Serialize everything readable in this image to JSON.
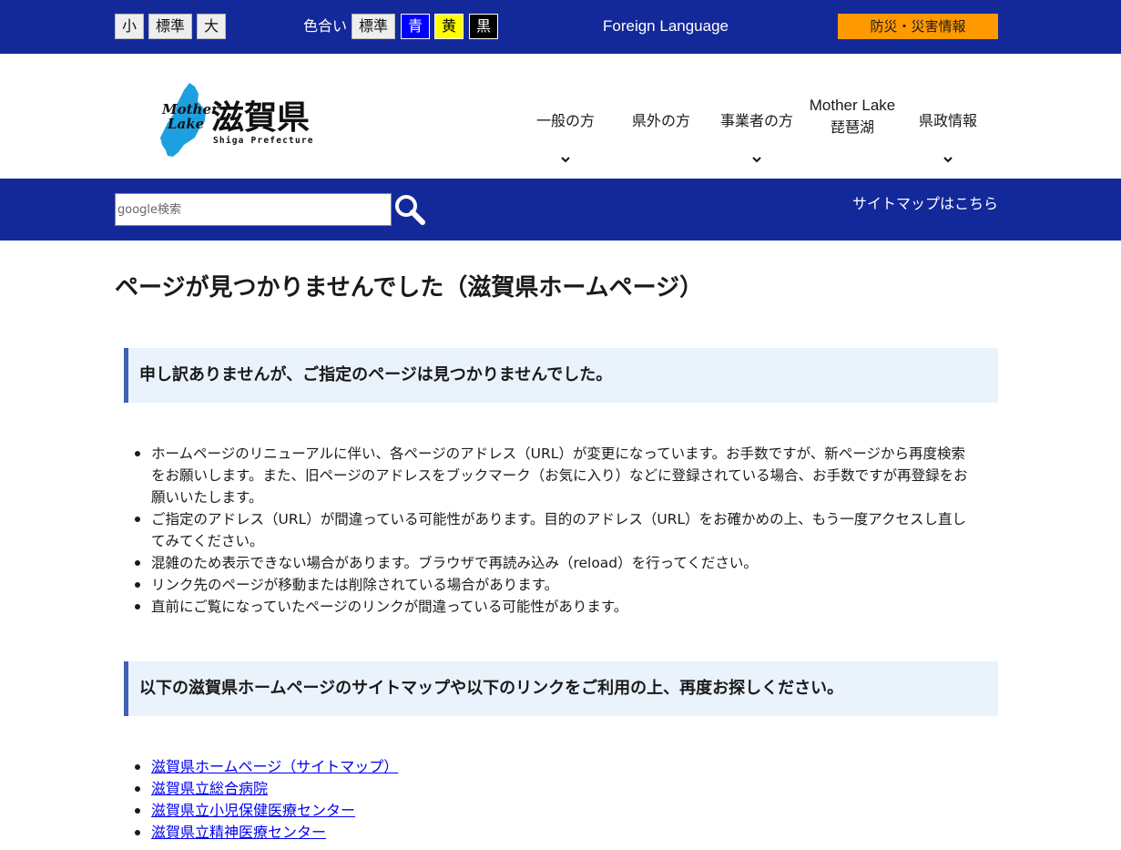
{
  "topbar": {
    "size_buttons": [
      "小",
      "標準",
      "大"
    ],
    "color_label": "色合い",
    "color_buttons": [
      {
        "label": "標準",
        "bg": "#eeeeee",
        "fg": "#111111"
      },
      {
        "label": "青",
        "bg": "#0000ff",
        "fg": "#ffffff"
      },
      {
        "label": "黄",
        "bg": "#ffff00",
        "fg": "#000000"
      },
      {
        "label": "黒",
        "bg": "#000000",
        "fg": "#ffffff"
      }
    ],
    "foreign_language": "Foreign Language",
    "disaster_info": "防災・災害情報"
  },
  "header": {
    "logo": {
      "mark_text": [
        "Mother",
        "Lake"
      ],
      "name": "滋賀県",
      "subtitle": "Shiga Prefecture"
    },
    "nav": [
      {
        "lines": [
          "一般の方"
        ],
        "has_dropdown": true
      },
      {
        "lines": [
          "県外の方"
        ],
        "has_dropdown": false
      },
      {
        "lines": [
          "事業者の方"
        ],
        "has_dropdown": true
      },
      {
        "lines": [
          "Mother Lake",
          "琵琶湖"
        ],
        "has_dropdown": false
      },
      {
        "lines": [
          "県政情報"
        ],
        "has_dropdown": true
      }
    ]
  },
  "search": {
    "placeholder": "google検索",
    "sitemap_link": "サイトマップはこちら"
  },
  "main": {
    "title": "ページが見つかりませんでした（滋賀県ホームページ）",
    "section1_heading": "申し訳ありませんが、ご指定のページは見つかりませんでした。",
    "reasons": [
      "ホームページのリニューアルに伴い、各ページのアドレス（URL）が変更になっています。お手数ですが、新ページから再度検索をお願いします。また、旧ページのアドレスをブックマーク（お気に入り）などに登録されている場合、お手数ですが再登録をお願いいたします。",
      "ご指定のアドレス（URL）が間違っている可能性があります。目的のアドレス（URL）をお確かめの上、もう一度アクセスし直してみてください。",
      "混雑のため表示できない場合があります。ブラウザで再読み込み（reload）を行ってください。",
      "リンク先のページが移動または削除されている場合があります。",
      "直前にご覧になっていたページのリンクが間違っている可能性があります。"
    ],
    "section2_heading": "以下の滋賀県ホームページのサイトマップや以下のリンクをご利用の上、再度お探しください。",
    "links": [
      "滋賀県ホームページ（サイトマップ）",
      "滋賀県立総合病院",
      "滋賀県立小児保健医療センター",
      "滋賀県立精神医療センター"
    ]
  },
  "colors": {
    "brand_navy": "#13299a",
    "disaster_orange": "#ff9900",
    "section_bg": "#eaf2fc",
    "section_border": "#3f5fb5",
    "link": "#0000ee"
  }
}
